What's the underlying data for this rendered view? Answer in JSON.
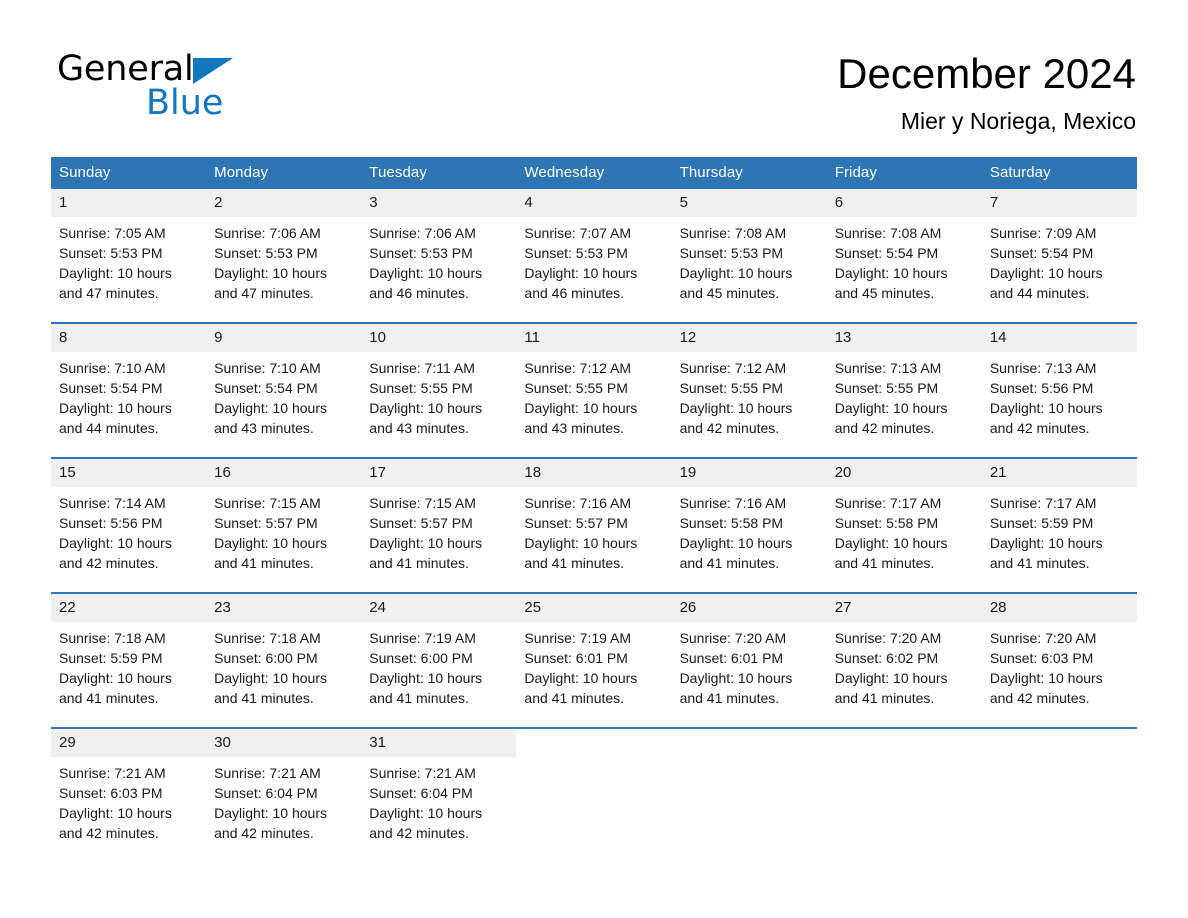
{
  "brand": {
    "name_part1": "General",
    "name_part2": "Blue",
    "triangle_icon": "triangle-icon",
    "accent_color": "#1278be"
  },
  "header": {
    "month_title": "December 2024",
    "location": "Mier y Noriega, Mexico"
  },
  "theme": {
    "header_blue": "#2e75b5",
    "daynum_bg": "#f0f0f0",
    "text": "#1a1a1a"
  },
  "weekday_headers": [
    "Sunday",
    "Monday",
    "Tuesday",
    "Wednesday",
    "Thursday",
    "Friday",
    "Saturday"
  ],
  "weeks": [
    [
      {
        "day": "1",
        "sunrise": "Sunrise: 7:05 AM",
        "sunset": "Sunset: 5:53 PM",
        "daylight_line1": "Daylight: 10 hours",
        "daylight_line2": "and 47 minutes."
      },
      {
        "day": "2",
        "sunrise": "Sunrise: 7:06 AM",
        "sunset": "Sunset: 5:53 PM",
        "daylight_line1": "Daylight: 10 hours",
        "daylight_line2": "and 47 minutes."
      },
      {
        "day": "3",
        "sunrise": "Sunrise: 7:06 AM",
        "sunset": "Sunset: 5:53 PM",
        "daylight_line1": "Daylight: 10 hours",
        "daylight_line2": "and 46 minutes."
      },
      {
        "day": "4",
        "sunrise": "Sunrise: 7:07 AM",
        "sunset": "Sunset: 5:53 PM",
        "daylight_line1": "Daylight: 10 hours",
        "daylight_line2": "and 46 minutes."
      },
      {
        "day": "5",
        "sunrise": "Sunrise: 7:08 AM",
        "sunset": "Sunset: 5:53 PM",
        "daylight_line1": "Daylight: 10 hours",
        "daylight_line2": "and 45 minutes."
      },
      {
        "day": "6",
        "sunrise": "Sunrise: 7:08 AM",
        "sunset": "Sunset: 5:54 PM",
        "daylight_line1": "Daylight: 10 hours",
        "daylight_line2": "and 45 minutes."
      },
      {
        "day": "7",
        "sunrise": "Sunrise: 7:09 AM",
        "sunset": "Sunset: 5:54 PM",
        "daylight_line1": "Daylight: 10 hours",
        "daylight_line2": "and 44 minutes."
      }
    ],
    [
      {
        "day": "8",
        "sunrise": "Sunrise: 7:10 AM",
        "sunset": "Sunset: 5:54 PM",
        "daylight_line1": "Daylight: 10 hours",
        "daylight_line2": "and 44 minutes."
      },
      {
        "day": "9",
        "sunrise": "Sunrise: 7:10 AM",
        "sunset": "Sunset: 5:54 PM",
        "daylight_line1": "Daylight: 10 hours",
        "daylight_line2": "and 43 minutes."
      },
      {
        "day": "10",
        "sunrise": "Sunrise: 7:11 AM",
        "sunset": "Sunset: 5:55 PM",
        "daylight_line1": "Daylight: 10 hours",
        "daylight_line2": "and 43 minutes."
      },
      {
        "day": "11",
        "sunrise": "Sunrise: 7:12 AM",
        "sunset": "Sunset: 5:55 PM",
        "daylight_line1": "Daylight: 10 hours",
        "daylight_line2": "and 43 minutes."
      },
      {
        "day": "12",
        "sunrise": "Sunrise: 7:12 AM",
        "sunset": "Sunset: 5:55 PM",
        "daylight_line1": "Daylight: 10 hours",
        "daylight_line2": "and 42 minutes."
      },
      {
        "day": "13",
        "sunrise": "Sunrise: 7:13 AM",
        "sunset": "Sunset: 5:55 PM",
        "daylight_line1": "Daylight: 10 hours",
        "daylight_line2": "and 42 minutes."
      },
      {
        "day": "14",
        "sunrise": "Sunrise: 7:13 AM",
        "sunset": "Sunset: 5:56 PM",
        "daylight_line1": "Daylight: 10 hours",
        "daylight_line2": "and 42 minutes."
      }
    ],
    [
      {
        "day": "15",
        "sunrise": "Sunrise: 7:14 AM",
        "sunset": "Sunset: 5:56 PM",
        "daylight_line1": "Daylight: 10 hours",
        "daylight_line2": "and 42 minutes."
      },
      {
        "day": "16",
        "sunrise": "Sunrise: 7:15 AM",
        "sunset": "Sunset: 5:57 PM",
        "daylight_line1": "Daylight: 10 hours",
        "daylight_line2": "and 41 minutes."
      },
      {
        "day": "17",
        "sunrise": "Sunrise: 7:15 AM",
        "sunset": "Sunset: 5:57 PM",
        "daylight_line1": "Daylight: 10 hours",
        "daylight_line2": "and 41 minutes."
      },
      {
        "day": "18",
        "sunrise": "Sunrise: 7:16 AM",
        "sunset": "Sunset: 5:57 PM",
        "daylight_line1": "Daylight: 10 hours",
        "daylight_line2": "and 41 minutes."
      },
      {
        "day": "19",
        "sunrise": "Sunrise: 7:16 AM",
        "sunset": "Sunset: 5:58 PM",
        "daylight_line1": "Daylight: 10 hours",
        "daylight_line2": "and 41 minutes."
      },
      {
        "day": "20",
        "sunrise": "Sunrise: 7:17 AM",
        "sunset": "Sunset: 5:58 PM",
        "daylight_line1": "Daylight: 10 hours",
        "daylight_line2": "and 41 minutes."
      },
      {
        "day": "21",
        "sunrise": "Sunrise: 7:17 AM",
        "sunset": "Sunset: 5:59 PM",
        "daylight_line1": "Daylight: 10 hours",
        "daylight_line2": "and 41 minutes."
      }
    ],
    [
      {
        "day": "22",
        "sunrise": "Sunrise: 7:18 AM",
        "sunset": "Sunset: 5:59 PM",
        "daylight_line1": "Daylight: 10 hours",
        "daylight_line2": "and 41 minutes."
      },
      {
        "day": "23",
        "sunrise": "Sunrise: 7:18 AM",
        "sunset": "Sunset: 6:00 PM",
        "daylight_line1": "Daylight: 10 hours",
        "daylight_line2": "and 41 minutes."
      },
      {
        "day": "24",
        "sunrise": "Sunrise: 7:19 AM",
        "sunset": "Sunset: 6:00 PM",
        "daylight_line1": "Daylight: 10 hours",
        "daylight_line2": "and 41 minutes."
      },
      {
        "day": "25",
        "sunrise": "Sunrise: 7:19 AM",
        "sunset": "Sunset: 6:01 PM",
        "daylight_line1": "Daylight: 10 hours",
        "daylight_line2": "and 41 minutes."
      },
      {
        "day": "26",
        "sunrise": "Sunrise: 7:20 AM",
        "sunset": "Sunset: 6:01 PM",
        "daylight_line1": "Daylight: 10 hours",
        "daylight_line2": "and 41 minutes."
      },
      {
        "day": "27",
        "sunrise": "Sunrise: 7:20 AM",
        "sunset": "Sunset: 6:02 PM",
        "daylight_line1": "Daylight: 10 hours",
        "daylight_line2": "and 41 minutes."
      },
      {
        "day": "28",
        "sunrise": "Sunrise: 7:20 AM",
        "sunset": "Sunset: 6:03 PM",
        "daylight_line1": "Daylight: 10 hours",
        "daylight_line2": "and 42 minutes."
      }
    ],
    [
      {
        "day": "29",
        "sunrise": "Sunrise: 7:21 AM",
        "sunset": "Sunset: 6:03 PM",
        "daylight_line1": "Daylight: 10 hours",
        "daylight_line2": "and 42 minutes."
      },
      {
        "day": "30",
        "sunrise": "Sunrise: 7:21 AM",
        "sunset": "Sunset: 6:04 PM",
        "daylight_line1": "Daylight: 10 hours",
        "daylight_line2": "and 42 minutes."
      },
      {
        "day": "31",
        "sunrise": "Sunrise: 7:21 AM",
        "sunset": "Sunset: 6:04 PM",
        "daylight_line1": "Daylight: 10 hours",
        "daylight_line2": "and 42 minutes."
      },
      {
        "day": "",
        "sunrise": "",
        "sunset": "",
        "daylight_line1": "",
        "daylight_line2": ""
      },
      {
        "day": "",
        "sunrise": "",
        "sunset": "",
        "daylight_line1": "",
        "daylight_line2": ""
      },
      {
        "day": "",
        "sunrise": "",
        "sunset": "",
        "daylight_line1": "",
        "daylight_line2": ""
      },
      {
        "day": "",
        "sunrise": "",
        "sunset": "",
        "daylight_line1": "",
        "daylight_line2": ""
      }
    ]
  ]
}
